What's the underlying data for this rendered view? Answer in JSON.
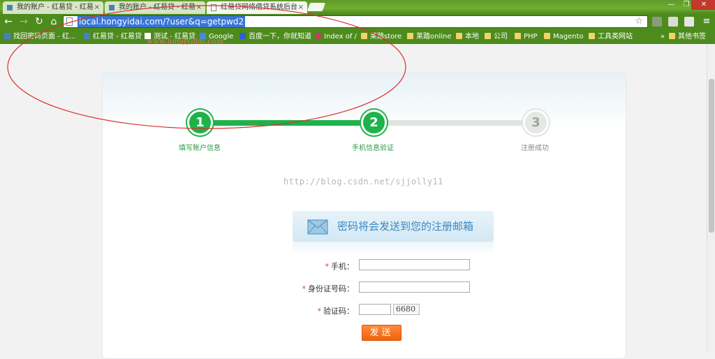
{
  "browser": {
    "tabs": [
      {
        "title": "我的账户 - 红易贷 - 红易",
        "state": "inactive"
      },
      {
        "title": "我的账户 - 红易贷 - 红易",
        "state": "inactive"
      },
      {
        "title": "红易贷网络借贷系统后台",
        "state": "active"
      }
    ],
    "url": "local.hongyidai.com/?user&q=getpwd2",
    "bookmarks": [
      {
        "label": "找回密码页面 - 红...",
        "icon": "favicon"
      },
      {
        "label": "红易贷 - 红易贷",
        "icon": "favicon"
      },
      {
        "label": "测试 - 红易贷",
        "icon": "page"
      },
      {
        "label": "Google",
        "icon": "google"
      },
      {
        "label": "百度一下，你就知道",
        "icon": "baidu"
      },
      {
        "label": "Index of /",
        "icon": "red"
      },
      {
        "label": "莱踏store",
        "icon": "folder"
      },
      {
        "label": "莱踏online",
        "icon": "folder"
      },
      {
        "label": "本地",
        "icon": "folder"
      },
      {
        "label": "公司",
        "icon": "folder"
      },
      {
        "label": "PHP",
        "icon": "folder"
      },
      {
        "label": "Magento",
        "icon": "folder"
      },
      {
        "label": "工具类网站",
        "icon": "folder"
      }
    ],
    "overflow_label": "»",
    "other_bookmarks": "其他书签"
  },
  "page": {
    "watermark": "www.hongyidai.com",
    "steps": [
      {
        "number": "1",
        "label": "填写账户信息",
        "state": "done"
      },
      {
        "number": "2",
        "label": "手机信息验证",
        "state": "current"
      },
      {
        "number": "3",
        "label": "注册成功",
        "state": "todo"
      }
    ],
    "csdn_watermark": "http://blog.csdn.net/sjjolly11",
    "banner_text": "密码将会发送到您的注册邮箱",
    "form": {
      "phone_label": "手机：",
      "id_label": "身份证号码：",
      "captcha_label": "验证码：",
      "required_mark": "*",
      "captcha_image_text": "6680",
      "send_label": "发送"
    }
  },
  "colors": {
    "accent_green": "#1fb24a",
    "step_inactive": "#e6e8e6",
    "banner_text": "#3a88c2",
    "send_button": "#f0620f",
    "annotation_red": "#d9302c"
  }
}
